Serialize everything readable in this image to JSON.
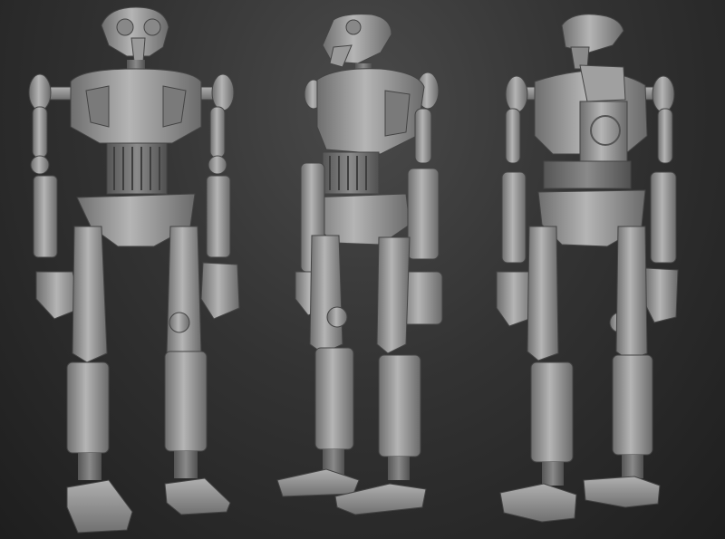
{
  "scene": {
    "subject": "robot-turnaround",
    "views": [
      {
        "id": "front",
        "label": ""
      },
      {
        "id": "three-quarter",
        "label": ""
      },
      {
        "id": "back",
        "label": ""
      }
    ],
    "colors": {
      "background_top": "#4a4a4a",
      "background_bottom": "#1e1e1e",
      "clay_light": "#b8b8b8",
      "clay_mid": "#8c8c8c",
      "clay_dark": "#5a5a5a",
      "clay_shadow": "#3c3c3c"
    }
  }
}
